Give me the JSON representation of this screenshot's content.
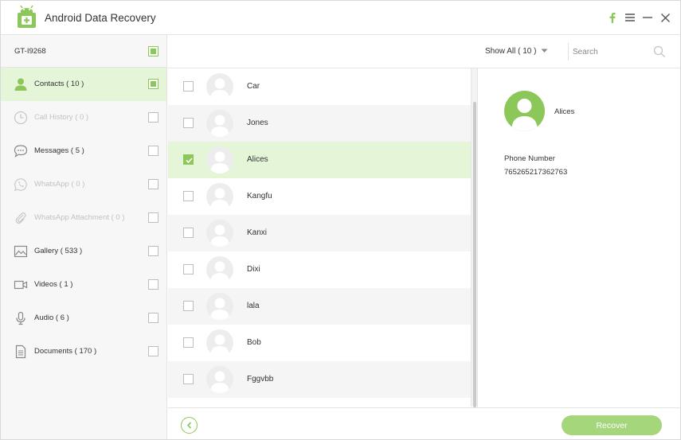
{
  "app": {
    "title": "Android Data Recovery",
    "logo_icon": "android-recovery-logo",
    "accent": "#8cc75a"
  },
  "window_controls": [
    {
      "name": "facebook-icon"
    },
    {
      "name": "menu-icon"
    },
    {
      "name": "minimize-icon"
    },
    {
      "name": "close-icon"
    }
  ],
  "sidebar": {
    "device": {
      "name": "GT-I9268",
      "checked": true
    },
    "items": [
      {
        "label": "Contacts ( 10 )",
        "icon": "contacts-icon",
        "active": true,
        "disabled": false,
        "checked": true
      },
      {
        "label": "Call History ( 0 )",
        "icon": "call-history-icon",
        "active": false,
        "disabled": true,
        "checked": false
      },
      {
        "label": "Messages ( 5 )",
        "icon": "messages-icon",
        "active": false,
        "disabled": false,
        "checked": false
      },
      {
        "label": "WhatsApp ( 0 )",
        "icon": "whatsapp-icon",
        "active": false,
        "disabled": true,
        "checked": false
      },
      {
        "label": "WhatsApp Attachment ( 0 )",
        "icon": "attachment-icon",
        "active": false,
        "disabled": true,
        "checked": false
      },
      {
        "label": "Gallery ( 533 )",
        "icon": "gallery-icon",
        "active": false,
        "disabled": false,
        "checked": false
      },
      {
        "label": "Videos ( 1 )",
        "icon": "videos-icon",
        "active": false,
        "disabled": false,
        "checked": false
      },
      {
        "label": "Audio ( 6 )",
        "icon": "audio-icon",
        "active": false,
        "disabled": false,
        "checked": false
      },
      {
        "label": "Documents ( 170 )",
        "icon": "documents-icon",
        "active": false,
        "disabled": false,
        "checked": false
      }
    ]
  },
  "toolbar": {
    "filter_label": "Show All ( 10 )",
    "search_placeholder": "Search"
  },
  "contacts": [
    {
      "name": "Car",
      "checked": false,
      "selected": false
    },
    {
      "name": "Jones",
      "checked": false,
      "selected": false
    },
    {
      "name": "Alices",
      "checked": true,
      "selected": true
    },
    {
      "name": "Kangfu",
      "checked": false,
      "selected": false
    },
    {
      "name": "Kanxi",
      "checked": false,
      "selected": false
    },
    {
      "name": "Dixi",
      "checked": false,
      "selected": false
    },
    {
      "name": "lala",
      "checked": false,
      "selected": false
    },
    {
      "name": "Bob",
      "checked": false,
      "selected": false
    },
    {
      "name": "Fggvbb",
      "checked": false,
      "selected": false
    }
  ],
  "detail": {
    "name": "Alices",
    "phone_label": "Phone Number",
    "phone_value": "765265217362763"
  },
  "footer": {
    "back_icon": "back-arrow-icon",
    "recover_label": "Recover"
  }
}
